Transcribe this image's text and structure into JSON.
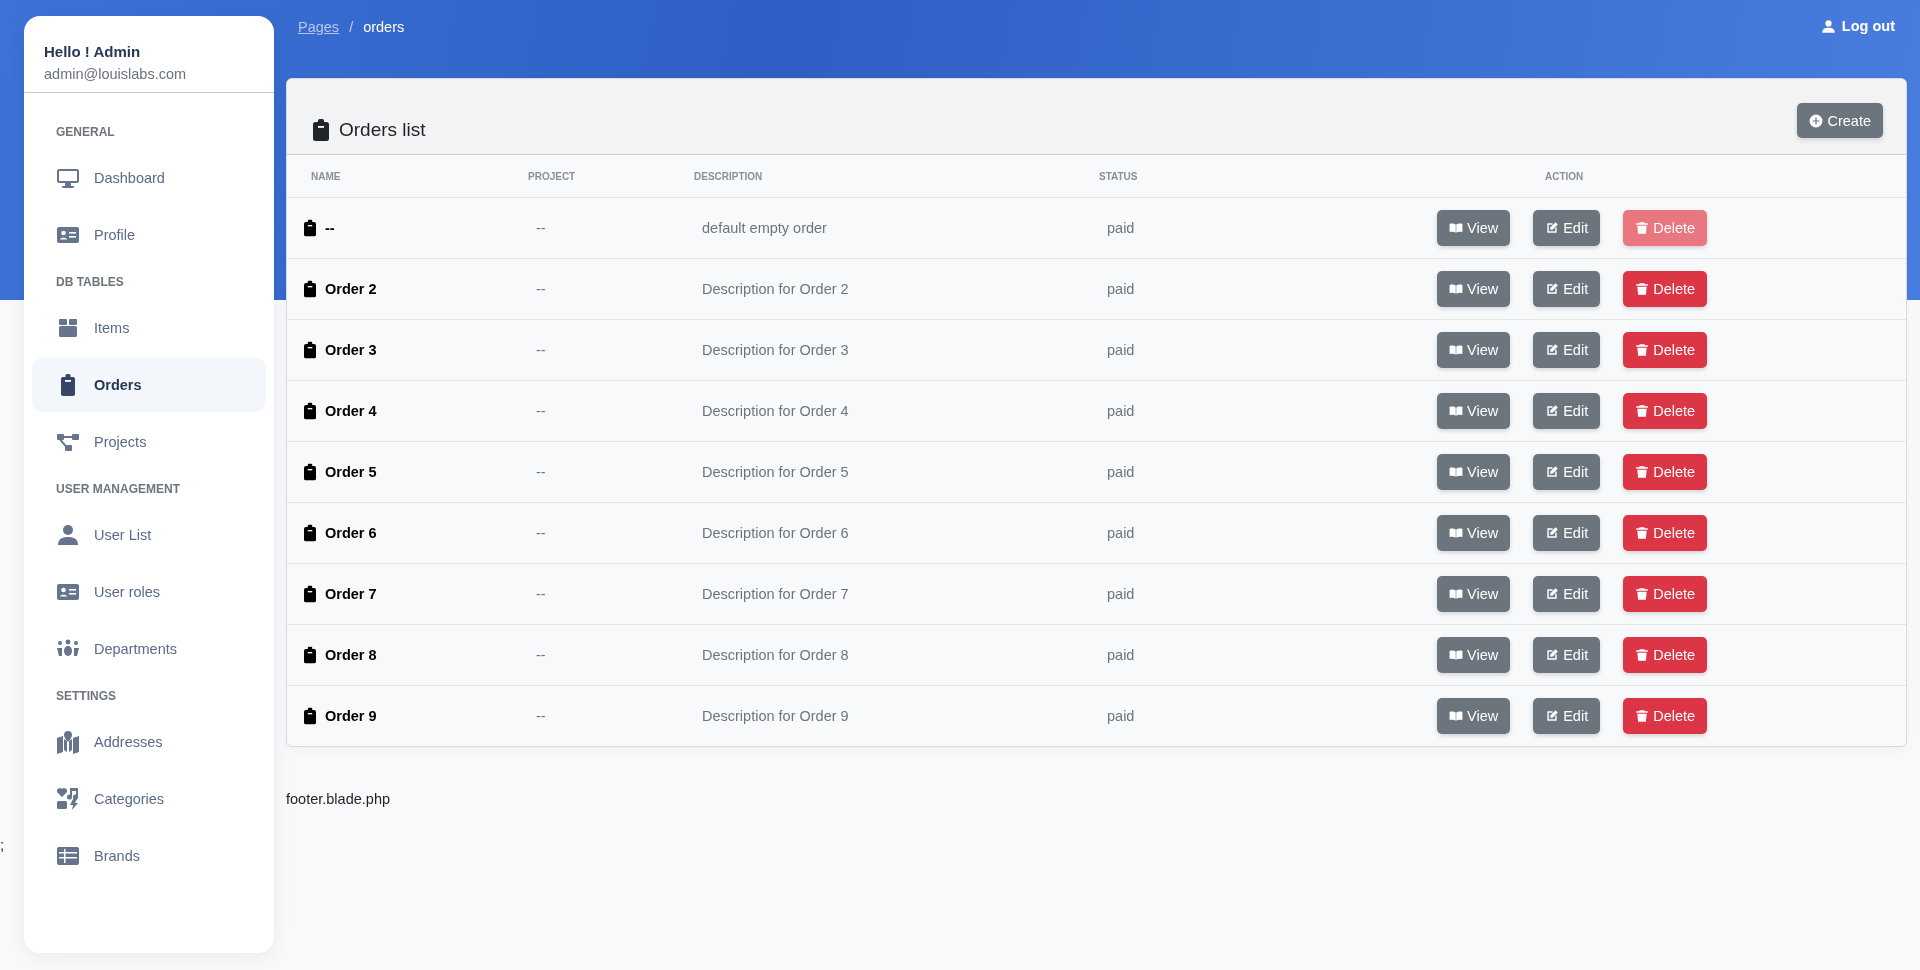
{
  "breadcrumb": {
    "parent": "Pages",
    "separator": "/",
    "current": "orders"
  },
  "logout": "Log out",
  "sidebar": {
    "greeting": "Hello ! Admin",
    "email": "admin@louislabs.com",
    "sections": [
      {
        "heading": "GENERAL",
        "items": [
          {
            "label": "Dashboard",
            "selected": false
          },
          {
            "label": "Profile",
            "selected": false
          }
        ]
      },
      {
        "heading": "DB TABLES",
        "items": [
          {
            "label": "Items",
            "selected": false
          },
          {
            "label": "Orders",
            "selected": true
          },
          {
            "label": "Projects",
            "selected": false
          }
        ]
      },
      {
        "heading": "USER MANAGEMENT",
        "items": [
          {
            "label": "User List",
            "selected": false
          },
          {
            "label": "User roles",
            "selected": false
          },
          {
            "label": "Departments",
            "selected": false
          }
        ]
      },
      {
        "heading": "SETTINGS",
        "items": [
          {
            "label": "Addresses",
            "selected": false
          },
          {
            "label": "Categories",
            "selected": false
          },
          {
            "label": "Brands",
            "selected": false
          }
        ]
      }
    ]
  },
  "orders": {
    "title": "Orders list",
    "create_button": "Create",
    "columns": [
      "NAME",
      "PROJECT",
      "DESCRIPTION",
      "STATUS",
      "ACTION"
    ],
    "rows": [
      {
        "name": "--",
        "project": "--",
        "description": "default empty order",
        "status": "paid",
        "view": "View",
        "edit": "Edit",
        "delete": "Delete",
        "delete_disabled": true
      },
      {
        "name": "Order 2",
        "project": "--",
        "description": "Description for Order 2",
        "status": "paid",
        "view": "View",
        "edit": "Edit",
        "delete": "Delete",
        "delete_disabled": false
      },
      {
        "name": "Order 3",
        "project": "--",
        "description": "Description for Order 3",
        "status": "paid",
        "view": "View",
        "edit": "Edit",
        "delete": "Delete",
        "delete_disabled": false
      },
      {
        "name": "Order 4",
        "project": "--",
        "description": "Description for Order 4",
        "status": "paid",
        "view": "View",
        "edit": "Edit",
        "delete": "Delete",
        "delete_disabled": false
      },
      {
        "name": "Order 5",
        "project": "--",
        "description": "Description for Order 5",
        "status": "paid",
        "view": "View",
        "edit": "Edit",
        "delete": "Delete",
        "delete_disabled": false
      },
      {
        "name": "Order 6",
        "project": "--",
        "description": "Description for Order 6",
        "status": "paid",
        "view": "View",
        "edit": "Edit",
        "delete": "Delete",
        "delete_disabled": false
      },
      {
        "name": "Order 7",
        "project": "--",
        "description": "Description for Order 7",
        "status": "paid",
        "view": "View",
        "edit": "Edit",
        "delete": "Delete",
        "delete_disabled": false
      },
      {
        "name": "Order 8",
        "project": "--",
        "description": "Description for Order 8",
        "status": "paid",
        "view": "View",
        "edit": "Edit",
        "delete": "Delete",
        "delete_disabled": false
      },
      {
        "name": "Order 9",
        "project": "--",
        "description": "Description for Order 9",
        "status": "paid",
        "view": "View",
        "edit": "Edit",
        "delete": "Delete",
        "delete_disabled": false
      }
    ]
  },
  "footer": "footer.blade.php",
  "stray_text": ";"
}
